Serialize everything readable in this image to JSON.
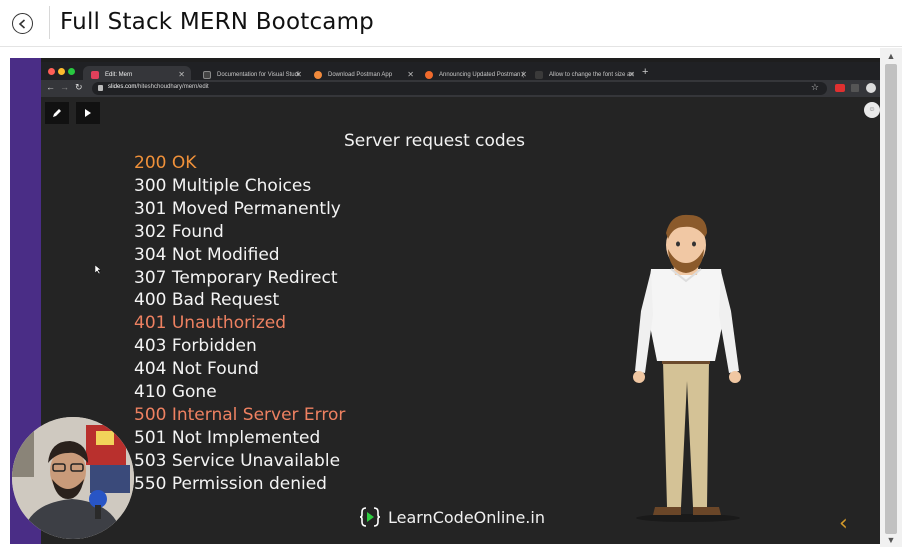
{
  "header": {
    "back_icon": "back-arrow-icon",
    "title": "Full Stack MERN Bootcamp"
  },
  "browser": {
    "tabs": [
      {
        "label": "Edit: Mern",
        "active": true,
        "favicon_color": "#e0405b"
      },
      {
        "label": "Documentation for Visual Studi",
        "active": false,
        "favicon_color": "#444444"
      },
      {
        "label": "Download Postman App",
        "active": false,
        "favicon_color": "#f08a3c"
      },
      {
        "label": "Announcing Updated Postman (",
        "active": false,
        "favicon_color": "#f06a2c"
      },
      {
        "label": "Allow to change the font size an",
        "active": false,
        "favicon_color": "#3a3a3a"
      }
    ],
    "url_host": "slides.com",
    "url_path": "/hiteshchoudhary/mern/edit"
  },
  "slide": {
    "title": "Server request codes",
    "codes": [
      {
        "text": "200 OK",
        "color": "orange"
      },
      {
        "text": "300 Multiple Choices",
        "color": "white"
      },
      {
        "text": "301 Moved Permanently",
        "color": "white"
      },
      {
        "text": "302 Found",
        "color": "white"
      },
      {
        "text": "304 Not Modified",
        "color": "white"
      },
      {
        "text": "307 Temporary Redirect",
        "color": "white"
      },
      {
        "text": "400 Bad Request",
        "color": "white"
      },
      {
        "text": "401 Unauthorized",
        "color": "salmon"
      },
      {
        "text": "403 Forbidden",
        "color": "white"
      },
      {
        "text": "404 Not Found",
        "color": "white"
      },
      {
        "text": "410 Gone",
        "color": "white"
      },
      {
        "text": "500 Internal Server Error",
        "color": "salmon"
      },
      {
        "text": "501 Not Implemented",
        "color": "white"
      },
      {
        "text": "503 Service Unavailable",
        "color": "white"
      },
      {
        "text": "550 Permission denied",
        "color": "white"
      }
    ],
    "brand": "LearnCodeOnline.in",
    "next_chevron": "‹"
  },
  "colors": {
    "orange": "#f0913a",
    "salmon": "#ee8161",
    "slide_bg": "#242424",
    "purple": "#4a2d86"
  }
}
